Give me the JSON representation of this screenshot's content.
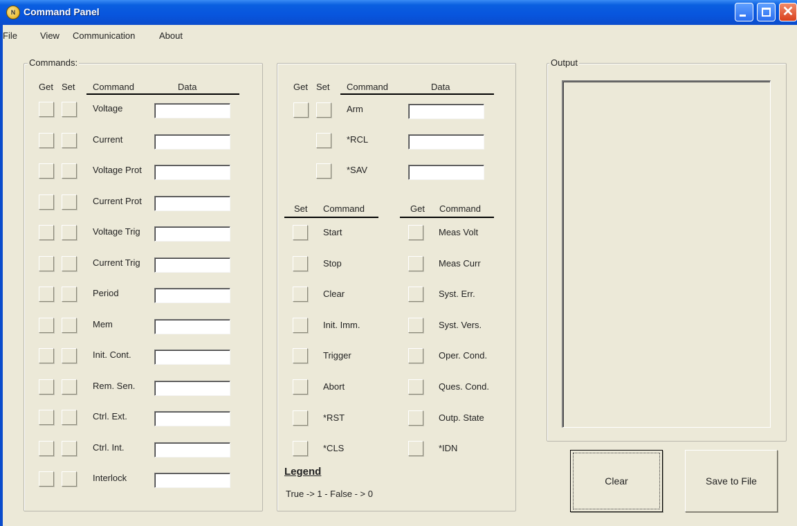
{
  "window": {
    "title": "Command Panel"
  },
  "menu": [
    "File",
    "View",
    "Communication",
    "About"
  ],
  "commands_group": {
    "label": "Commands:",
    "headers": {
      "get": "Get",
      "set": "Set",
      "command": "Command",
      "data": "Data"
    },
    "rows": [
      {
        "label": "Voltage",
        "value": ""
      },
      {
        "label": "Current",
        "value": ""
      },
      {
        "label": "Voltage Prot",
        "value": ""
      },
      {
        "label": "Current Prot",
        "value": ""
      },
      {
        "label": "Voltage Trig",
        "value": ""
      },
      {
        "label": "Current Trig",
        "value": ""
      },
      {
        "label": "Period",
        "value": ""
      },
      {
        "label": "Mem",
        "value": ""
      },
      {
        "label": "Init. Cont.",
        "value": ""
      },
      {
        "label": "Rem. Sen.",
        "value": ""
      },
      {
        "label": "Ctrl. Ext.",
        "value": ""
      },
      {
        "label": "Ctrl. Int.",
        "value": ""
      },
      {
        "label": "Interlock",
        "value": ""
      }
    ]
  },
  "middle_group": {
    "headers": {
      "get": "Get",
      "set": "Set",
      "command": "Command",
      "data": "Data"
    },
    "top_rows": [
      {
        "label": "Arm",
        "has_get": true,
        "value": ""
      },
      {
        "label": "*RCL",
        "has_get": false,
        "value": ""
      },
      {
        "label": "*SAV",
        "has_get": false,
        "value": ""
      }
    ],
    "set_header": {
      "set": "Set",
      "command": "Command"
    },
    "get_header": {
      "get": "Get",
      "command": "Command"
    },
    "set_commands": [
      "Start",
      "Stop",
      "Clear",
      "Init. Imm.",
      "Trigger",
      "Abort",
      "*RST",
      "*CLS"
    ],
    "get_commands": [
      "Meas Volt",
      "Meas Curr",
      "Syst. Err.",
      "Syst. Vers.",
      "Oper. Cond.",
      "Ques. Cond.",
      "Outp. State",
      "*IDN"
    ],
    "legend_title": "Legend",
    "legend_text": "True  -> 1 - False - > 0"
  },
  "output_group": {
    "label": "Output",
    "clear_button": "Clear",
    "save_button": "Save to File"
  }
}
